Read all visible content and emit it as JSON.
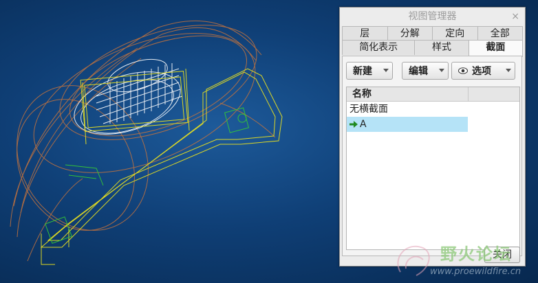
{
  "viewport": {
    "background_color": "#0f3f76",
    "model_colors": {
      "frame": "#e8e020",
      "gears": "#ffffff",
      "housing": "#c8743c",
      "parts": "#36c836"
    }
  },
  "dialog": {
    "title": "视图管理器",
    "close_glyph": "×",
    "tabs_row1": [
      "层",
      "分解",
      "定向",
      "全部"
    ],
    "tabs_row2": [
      "简化表示",
      "样式",
      "截面"
    ],
    "active_tab": "截面",
    "toolbar": {
      "new_label": "新建",
      "edit_label": "编辑",
      "options_label": "选项"
    },
    "list": {
      "header": "名称",
      "items": [
        "无横截面",
        "A"
      ],
      "selected": "A"
    },
    "close_button_label": "关闭"
  },
  "watermark": {
    "title": "野火论坛",
    "url": "www.proewildfire.cn"
  }
}
